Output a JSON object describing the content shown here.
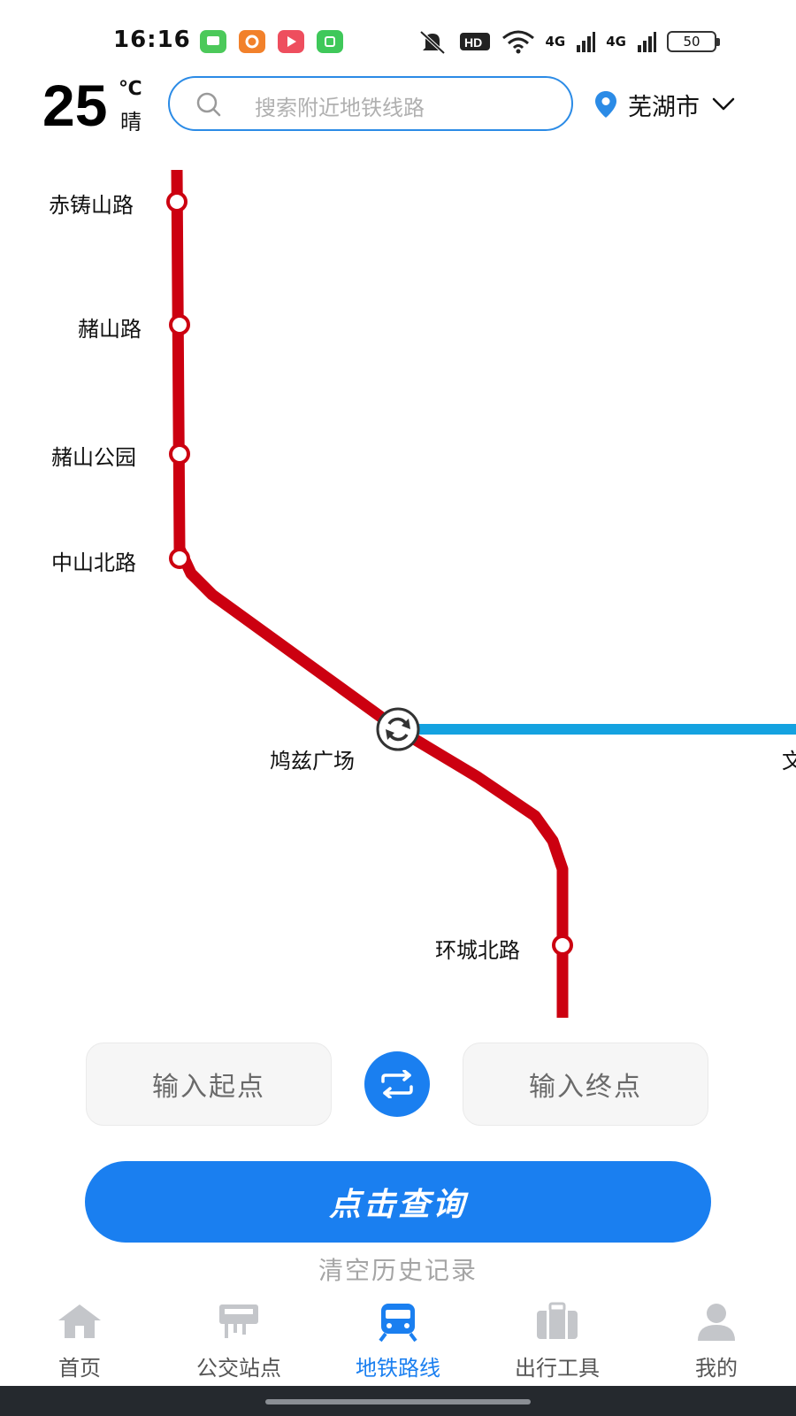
{
  "status_bar": {
    "time": "16:16",
    "app_icons": [
      {
        "name": "messages-app-icon",
        "color": "#4cc95a"
      },
      {
        "name": "orange-app-icon",
        "color": "#f2812b"
      },
      {
        "name": "video-app-icon",
        "color": "#ee4e5e"
      },
      {
        "name": "green-app-icon",
        "color": "#3fc85a"
      }
    ],
    "hd_badge": "HD",
    "signal_1": "4G",
    "signal_2": "4G",
    "battery": "50"
  },
  "header": {
    "temperature": "25",
    "temp_unit": "℃",
    "weather": "晴",
    "search_placeholder": "搜索附近地铁线路",
    "city": "芜湖市"
  },
  "map": {
    "line_colors": {
      "line1": "#cc0010",
      "line2": "#14a2e0"
    },
    "stations": [
      "赤铸山路",
      "赭山路",
      "赭山公园",
      "中山北路",
      "鸠兹广场",
      "环城北路",
      "文"
    ],
    "transfer_station": "鸠兹广场"
  },
  "route": {
    "start_placeholder": "输入起点",
    "end_placeholder": "输入终点",
    "query_label": "点击查询",
    "clear_history": "清空历史记录"
  },
  "nav": {
    "active_color": "#1a7ff0",
    "items": [
      {
        "label": "首页",
        "icon": "home-icon"
      },
      {
        "label": "公交站点",
        "icon": "bus-stop-icon"
      },
      {
        "label": "地铁路线",
        "icon": "subway-icon"
      },
      {
        "label": "出行工具",
        "icon": "toolbox-icon"
      },
      {
        "label": "我的",
        "icon": "profile-icon"
      }
    ],
    "active_index": 2
  }
}
